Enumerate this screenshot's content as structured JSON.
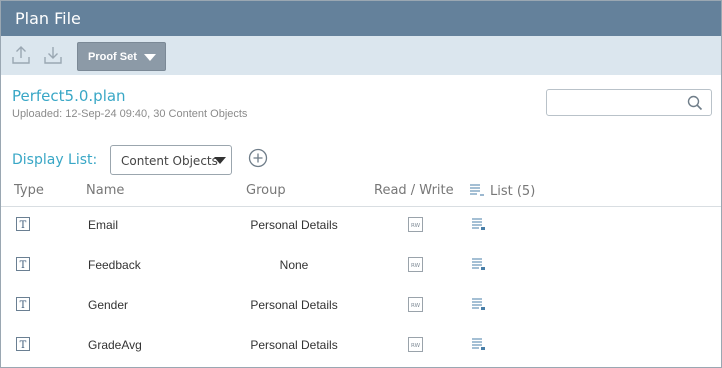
{
  "window": {
    "title": "Plan File"
  },
  "toolbar": {
    "upload_icon": "upload-icon",
    "download_icon": "download-icon",
    "proof_set_label": "Proof Set"
  },
  "plan": {
    "name": "Perfect5.0.plan",
    "meta": "Uploaded: 12-Sep-24 09:40, 30 Content Objects"
  },
  "search": {
    "placeholder": "",
    "value": ""
  },
  "display_list": {
    "label": "Display List:",
    "selected": "Content Objects"
  },
  "table": {
    "headers": {
      "type": "Type",
      "name": "Name",
      "group": "Group",
      "read_write": "Read / Write",
      "list": "List (5)"
    },
    "rows": [
      {
        "type": "T",
        "name": "Email",
        "group": "Personal Details",
        "rw": "RW"
      },
      {
        "type": "T",
        "name": "Feedback",
        "group": "None",
        "rw": "RW"
      },
      {
        "type": "T",
        "name": "Gender",
        "group": "Personal Details",
        "rw": "RW"
      },
      {
        "type": "T",
        "name": "GradeAvg",
        "group": "Personal Details",
        "rw": "RW"
      }
    ]
  },
  "colors": {
    "titlebar": "#64819b",
    "toolbar": "#dbe6ee",
    "accent": "#39a7c6",
    "button": "#8c9aa7"
  }
}
